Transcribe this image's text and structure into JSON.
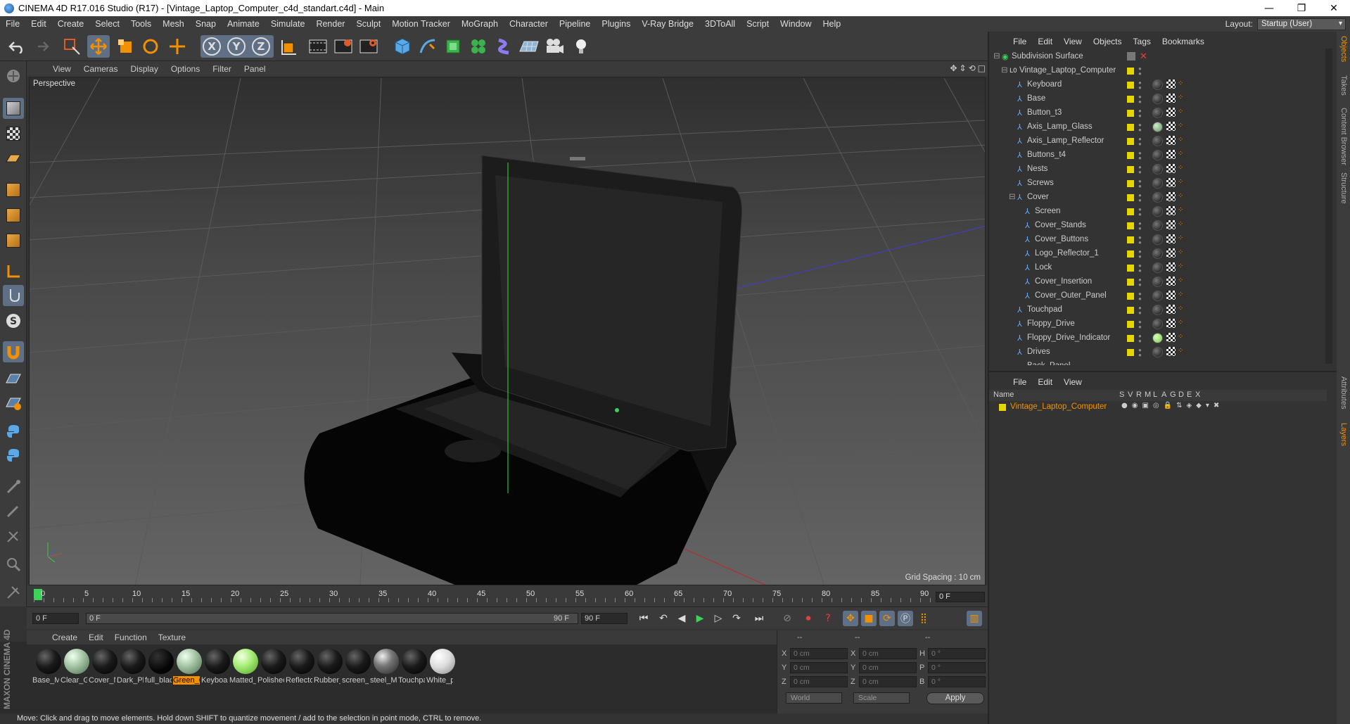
{
  "window": {
    "title": "CINEMA 4D R17.016 Studio (R17) - [Vintage_Laptop_Computer_c4d_standart.c4d] - Main",
    "buttons": [
      "—",
      "❐",
      "✕"
    ]
  },
  "menubar": {
    "items": [
      "File",
      "Edit",
      "Create",
      "Select",
      "Tools",
      "Mesh",
      "Snap",
      "Animate",
      "Simulate",
      "Render",
      "Sculpt",
      "Motion Tracker",
      "MoGraph",
      "Character",
      "Pipeline",
      "Plugins",
      "V-Ray Bridge",
      "3DToAll",
      "Script",
      "Window",
      "Help"
    ],
    "layout_label": "Layout:",
    "layout_value": "Startup (User)"
  },
  "toolbar": {
    "axis_x": "X",
    "axis_y": "Y",
    "axis_z": "Z"
  },
  "viewport": {
    "menu": [
      "View",
      "Cameras",
      "Display",
      "Options",
      "Filter",
      "Panel"
    ],
    "nav_icons": "✥⇕⟲□",
    "label": "Perspective",
    "grid_spacing": "Grid Spacing : 10 cm"
  },
  "timeline": {
    "ticks": [
      "0",
      "5",
      "10",
      "15",
      "20",
      "25",
      "30",
      "35",
      "40",
      "45",
      "50",
      "55",
      "60",
      "65",
      "70",
      "75",
      "80",
      "85",
      "90"
    ],
    "current_frame": "0 F"
  },
  "transport": {
    "start_field": "0 F",
    "range_start": "0 F",
    "range_end": "90 F",
    "end_field": "90 F"
  },
  "material_manager": {
    "menu": [
      "Create",
      "Edit",
      "Function",
      "Texture"
    ],
    "materials": [
      {
        "name": "Base_Ma",
        "type": "dark"
      },
      {
        "name": "Clear_Gl",
        "type": "glass"
      },
      {
        "name": "Cover_M",
        "type": "dark"
      },
      {
        "name": "Dark_Pla",
        "type": "dark"
      },
      {
        "name": "full_blac",
        "type": "black"
      },
      {
        "name": "Green_G",
        "type": "glass",
        "selected": true
      },
      {
        "name": "Keyboar",
        "type": "dark"
      },
      {
        "name": "Matted_",
        "type": "green"
      },
      {
        "name": "Polishec",
        "type": "dark"
      },
      {
        "name": "Reflecto",
        "type": "dark"
      },
      {
        "name": "Rubber_",
        "type": "dark"
      },
      {
        "name": "screen_l",
        "type": "dark"
      },
      {
        "name": "steel_M",
        "type": "steel"
      },
      {
        "name": "Touchpa",
        "type": "dark"
      },
      {
        "name": "White_p",
        "type": "white"
      }
    ]
  },
  "coordinates": {
    "header": [
      "--",
      "--",
      "--"
    ],
    "rows": [
      {
        "a": "X",
        "av": "0 cm",
        "b": "X",
        "bv": "0 cm",
        "c": "H",
        "cv": "0 °"
      },
      {
        "a": "Y",
        "av": "0 cm",
        "b": "Y",
        "bv": "0 cm",
        "c": "P",
        "cv": "0 °"
      },
      {
        "a": "Z",
        "av": "0 cm",
        "b": "Z",
        "bv": "0 cm",
        "c": "B",
        "cv": "0 °"
      }
    ],
    "world": "World",
    "scale": "Scale",
    "apply": "Apply"
  },
  "object_manager": {
    "menu": [
      "File",
      "Edit",
      "View",
      "Objects",
      "Tags",
      "Bookmarks"
    ],
    "objects": [
      {
        "name": "Subdivision Surface",
        "level": 0,
        "icon": "subdiv"
      },
      {
        "name": "Vintage_Laptop_Computer",
        "level": 1,
        "icon": "null"
      },
      {
        "name": "Keyboard",
        "level": 2,
        "icon": "poly"
      },
      {
        "name": "Base",
        "level": 2,
        "icon": "poly"
      },
      {
        "name": "Button_t3",
        "level": 2,
        "icon": "poly"
      },
      {
        "name": "Axis_Lamp_Glass",
        "level": 2,
        "icon": "poly",
        "mat": "glass"
      },
      {
        "name": "Axis_Lamp_Reflector",
        "level": 2,
        "icon": "poly"
      },
      {
        "name": "Buttons_t4",
        "level": 2,
        "icon": "poly"
      },
      {
        "name": "Nests",
        "level": 2,
        "icon": "poly"
      },
      {
        "name": "Screws",
        "level": 2,
        "icon": "poly"
      },
      {
        "name": "Cover",
        "level": 2,
        "icon": "poly"
      },
      {
        "name": "Screen",
        "level": 3,
        "icon": "poly"
      },
      {
        "name": "Cover_Stands",
        "level": 3,
        "icon": "poly"
      },
      {
        "name": "Cover_Buttons",
        "level": 3,
        "icon": "poly"
      },
      {
        "name": "Logo_Reflector_1",
        "level": 3,
        "icon": "poly"
      },
      {
        "name": "Lock",
        "level": 3,
        "icon": "poly"
      },
      {
        "name": "Cover_Insertion",
        "level": 3,
        "icon": "poly"
      },
      {
        "name": "Cover_Outer_Panel",
        "level": 3,
        "icon": "poly"
      },
      {
        "name": "Touchpad",
        "level": 2,
        "icon": "poly"
      },
      {
        "name": "Floppy_Drive",
        "level": 2,
        "icon": "poly"
      },
      {
        "name": "Floppy_Drive_Indicator",
        "level": 2,
        "icon": "poly",
        "mat": "green"
      },
      {
        "name": "Drives",
        "level": 2,
        "icon": "poly"
      }
    ],
    "partial_row": "Back_Panel"
  },
  "layer_manager": {
    "menu": [
      "File",
      "Edit",
      "View"
    ],
    "columns": [
      "Name",
      "S",
      "V",
      "R",
      "M",
      "L",
      "A",
      "G",
      "D",
      "E",
      "X"
    ],
    "layer": "Vintage_Laptop_Computer"
  },
  "side_tabs": [
    "Objects",
    "Takes",
    "Content Browser",
    "Structure",
    "Attributes",
    "Layers"
  ],
  "statusbar": "Move: Click and drag to move elements. Hold down SHIFT to quantize movement / add to the selection in point mode, CTRL to remove.",
  "brand": "MAXON CINEMA 4D",
  "colors": {
    "accent": "#f29100",
    "selection": "#5f6f86",
    "layer": "#e6d600"
  }
}
